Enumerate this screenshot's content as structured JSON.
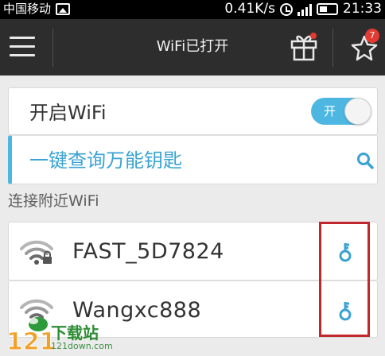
{
  "status_bar": {
    "carrier": "中国移动",
    "speed": "0.41K/s",
    "time": "21:33",
    "icons": [
      "image-icon",
      "alarm-icon",
      "signal-icon",
      "battery-icon"
    ]
  },
  "app_bar": {
    "title": "WiFi已打开",
    "star_badge_count": "7",
    "icons": [
      "menu-icon",
      "gift-icon",
      "star-icon"
    ]
  },
  "wifi_toggle": {
    "label": "开启WiFi",
    "switch_text": "开",
    "enabled": true
  },
  "query": {
    "label": "一键查询万能钥匙",
    "icon": "search-icon"
  },
  "section": {
    "title": "连接附近WiFi"
  },
  "networks": [
    {
      "name": "FAST_5D7824",
      "locked": true,
      "action_icon": "key-icon"
    },
    {
      "name": "Wangxc888",
      "locked": false,
      "action_icon": "key-icon"
    }
  ],
  "watermark": {
    "number": "121",
    "text": "下载站",
    "url": "121down.com"
  },
  "colors": {
    "accent": "#4db6e1",
    "query_text": "#3aa3d3",
    "appbar": "#2d2d2d",
    "badge": "#e23b33",
    "highlight_box": "#c1272d"
  }
}
